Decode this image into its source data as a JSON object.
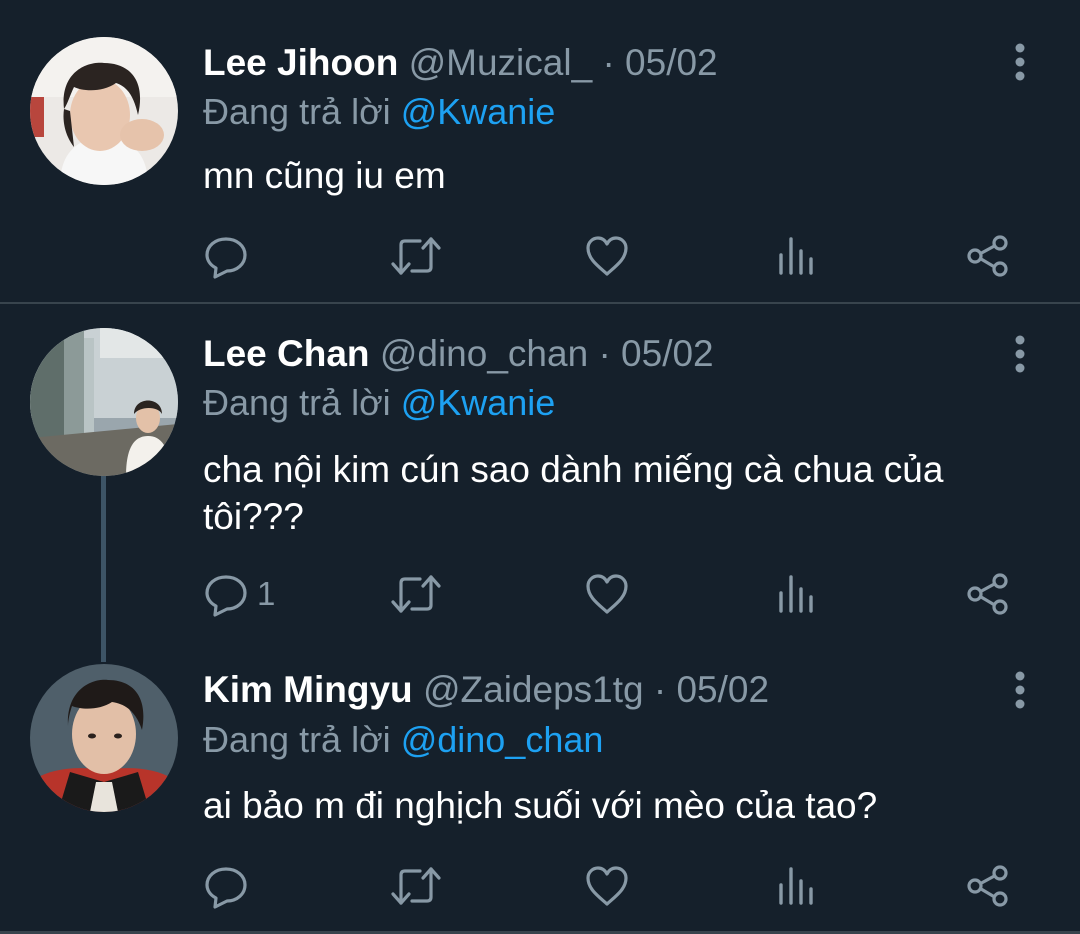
{
  "separator": "·",
  "reply_prefix": "Đang trả lời",
  "colors": {
    "background": "#15202b",
    "secondary_text": "#8899a6",
    "mention": "#1da1f2",
    "divider": "#38444d"
  },
  "tweets": [
    {
      "name": "Lee Jihoon",
      "handle": "@Muzical_",
      "date": "05/02",
      "reply_to": "@Kwanie",
      "text": "mn cũng iu em",
      "reply_count": ""
    },
    {
      "name": "Lee Chan",
      "handle": "@dino_chan",
      "date": "05/02",
      "reply_to": "@Kwanie",
      "text": "cha nội kim cún sao dành miếng cà chua của tôi???",
      "reply_count": "1"
    },
    {
      "name": "Kim Mingyu",
      "handle": "@Zaideps1tg",
      "date": "05/02",
      "reply_to": "@dino_chan",
      "text": "ai bảo m đi nghịch suối với mèo của tao?",
      "reply_count": ""
    }
  ],
  "action_icons": [
    "reply-icon",
    "retweet-icon",
    "like-icon",
    "analytics-icon",
    "share-icon"
  ],
  "more_icon": "more-vertical-icon"
}
